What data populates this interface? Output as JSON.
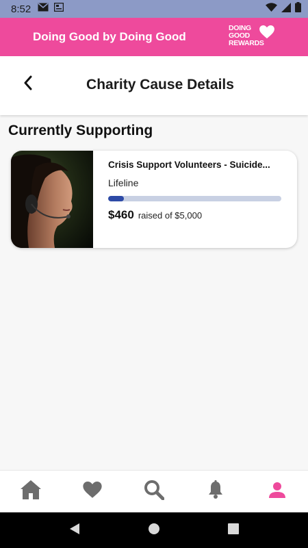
{
  "status_bar": {
    "time": "8:52"
  },
  "promo": {
    "title": "Doing Good by Doing Good",
    "logo_line1": "DOING",
    "logo_line2": "GOOD",
    "logo_line3": "REWARDS"
  },
  "header": {
    "title": "Charity Cause Details"
  },
  "section": {
    "title": "Currently Supporting"
  },
  "cause": {
    "name": "Crisis Support Volunteers  - Suicide...",
    "organization": "Lifeline",
    "raised": "$460",
    "raised_of": "raised of $5,000",
    "progress_fraction": 0.092
  },
  "nav": {
    "items": [
      "home-icon",
      "heart-icon",
      "search-icon",
      "bell-icon",
      "profile-icon"
    ],
    "active": "profile-icon"
  },
  "colors": {
    "brand_pink": "#ee4a9c",
    "status_bar": "#8c9ac6",
    "progress": "#2d4aa6",
    "nav_inactive": "#6d6d6d"
  }
}
